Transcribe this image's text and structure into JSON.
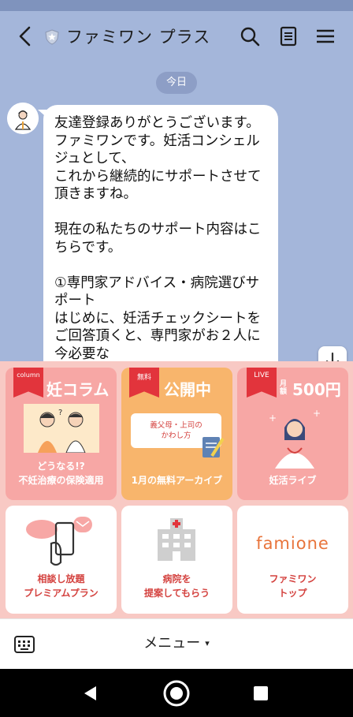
{
  "header": {
    "account_name": "ファミワン プラス",
    "icons": [
      "chevron-left-icon",
      "official-shield-icon",
      "search-icon",
      "notes-icon",
      "hamburger-menu-icon"
    ]
  },
  "chat": {
    "date_label": "今日",
    "message": "友達登録ありがとうございます。\nファミワンです。妊活コンシェルジュとして、\nこれから継続的にサポートさせて頂きますね。\n\n現在の私たちのサポート内容はこちらです。\n\n①専門家アドバイス・病院選びサポート\nはじめに、妊活チェックシートをご回答頂くと、専門家がお２人に今必要な"
  },
  "rich_menu": {
    "column": {
      "ribbon": "column",
      "title": "妊コラム",
      "subtitle": "どうなる!?",
      "caption": "不妊治療の保険適用"
    },
    "archive": {
      "ribbon": "無料",
      "title": "公開中",
      "card_text": "義父母・上司の\nかわし方",
      "caption": "1月の無料アーカイブ"
    },
    "live": {
      "ribbon": "LIVE",
      "price_prefix": "月額",
      "price": "500円",
      "caption": "妊活ライブ"
    },
    "consult": {
      "label": "相談し放題\nプレミアムプラン"
    },
    "hospital": {
      "label": "病院を\n提案してもらう"
    },
    "top": {
      "logo": "famione",
      "label": "ファミワン\nトップ"
    }
  },
  "bottom_bar": {
    "menu_label": "メニュー",
    "caret": "▾"
  },
  "colors": {
    "background": "#a4b6da",
    "rich_menu_bg": "#f8c9c4",
    "pink_card": "#f7a7a5",
    "orange_card": "#f8b56c",
    "accent_red": "#e2343c",
    "label_red": "#d4423f",
    "logo_orange": "#e8743b"
  }
}
